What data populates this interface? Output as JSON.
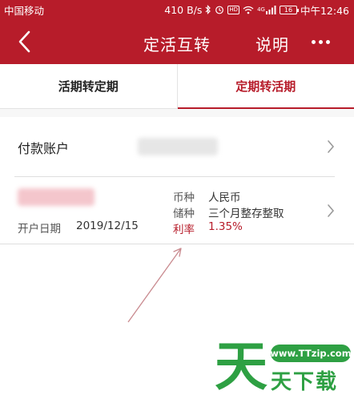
{
  "status_bar": {
    "carrier": "中国移动",
    "speed": "410 B/s",
    "network": "4G",
    "battery": "16",
    "time": "中午12:46"
  },
  "nav": {
    "title": "定活互转",
    "explain": "说明"
  },
  "tabs": [
    {
      "label": "活期转定期",
      "active": false
    },
    {
      "label": "定期转活期",
      "active": true
    }
  ],
  "account": {
    "label": "付款账户"
  },
  "deposit": {
    "open_date_label": "开户日期",
    "open_date": "2019/12/15",
    "details": [
      {
        "key": "币种",
        "value": "人民币"
      },
      {
        "key": "储种",
        "value": "三个月整存整取"
      },
      {
        "key": "利率",
        "value": "1.35%"
      }
    ]
  },
  "watermark": {
    "big": "天",
    "site": "www.TTzip.com",
    "sub": "天下载"
  },
  "colors": {
    "brand": "#b71c2a",
    "watermark": "#2ea043"
  }
}
